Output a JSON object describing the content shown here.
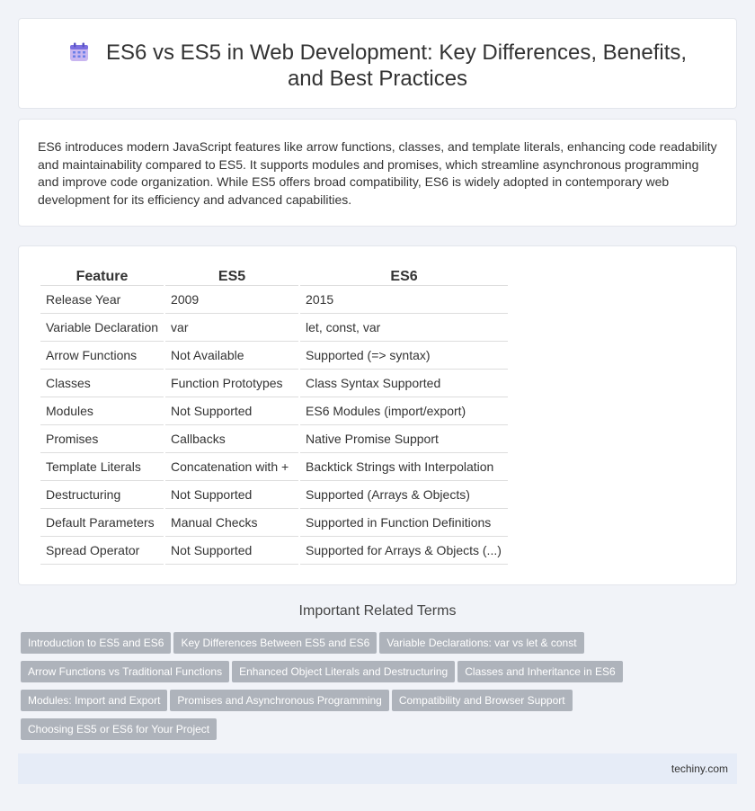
{
  "header": {
    "title": "ES6 vs ES5 in Web Development: Key Differences, Benefits, and Best Practices",
    "icon": "calendar-icon"
  },
  "summary": "ES6 introduces modern JavaScript features like arrow functions, classes, and template literals, enhancing code readability and maintainability compared to ES5. It supports modules and promises, which streamline asynchronous programming and improve code organization. While ES5 offers broad compatibility, ES6 is widely adopted in contemporary web development for its efficiency and advanced capabilities.",
  "table": {
    "headers": [
      "Feature",
      "ES5",
      "ES6"
    ],
    "rows": [
      [
        "Release Year",
        "2009",
        "2015"
      ],
      [
        "Variable Declaration",
        "var",
        "let, const, var"
      ],
      [
        "Arrow Functions",
        "Not Available",
        "Supported (=> syntax)"
      ],
      [
        "Classes",
        "Function Prototypes",
        "Class Syntax Supported"
      ],
      [
        "Modules",
        "Not Supported",
        "ES6 Modules (import/export)"
      ],
      [
        "Promises",
        "Callbacks",
        "Native Promise Support"
      ],
      [
        "Template Literals",
        "Concatenation with +",
        "Backtick Strings with Interpolation"
      ],
      [
        "Destructuring",
        "Not Supported",
        "Supported (Arrays & Objects)"
      ],
      [
        "Default Parameters",
        "Manual Checks",
        "Supported in Function Definitions"
      ],
      [
        "Spread Operator",
        "Not Supported",
        "Supported for Arrays & Objects (...)"
      ]
    ]
  },
  "related": {
    "title": "Important Related Terms",
    "tags": [
      "Introduction to ES5 and ES6",
      "Key Differences Between ES5 and ES6",
      "Variable Declarations: var vs let & const",
      "Arrow Functions vs Traditional Functions",
      "Enhanced Object Literals and Destructuring",
      "Classes and Inheritance in ES6",
      "Modules: Import and Export",
      "Promises and Asynchronous Programming",
      "Compatibility and Browser Support",
      "Choosing ES5 or ES6 for Your Project"
    ]
  },
  "footer": {
    "site": "techiny.com"
  },
  "colors": {
    "tag_bg": "#aeb3bb",
    "page_bg": "#f1f3f8",
    "footer_bg": "#e6ecf7"
  }
}
